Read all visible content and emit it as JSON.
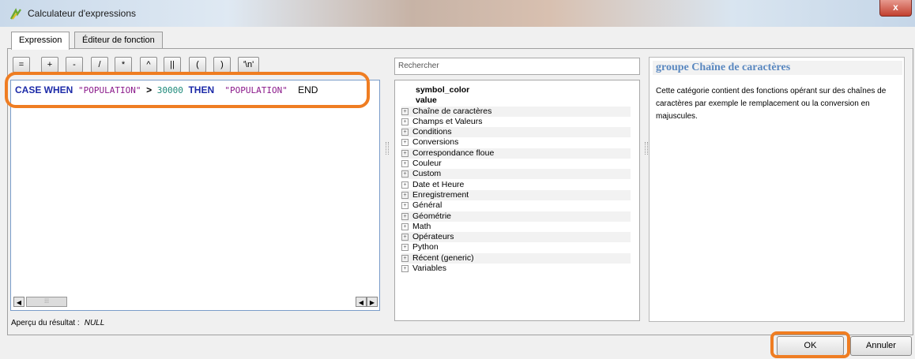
{
  "window": {
    "title": "Calculateur d'expressions",
    "help_label": "?",
    "close_label": "x"
  },
  "tabs": [
    {
      "label": "Expression"
    },
    {
      "label": "Éditeur de fonction"
    }
  ],
  "operators": [
    "=",
    "+",
    "-",
    "/",
    "*",
    "^",
    "||",
    "(",
    ")",
    "'\\n'"
  ],
  "editor": {
    "tokens": {
      "kw1": "CASE WHEN",
      "field1": "\"POPULATION\"",
      "op": ">",
      "num": "30000",
      "kw2": "THEN",
      "field2": "\"POPULATION\"",
      "end": "END"
    }
  },
  "preview": {
    "label": "Aperçu du résultat :",
    "value": "NULL"
  },
  "search": {
    "placeholder": "Rechercher"
  },
  "tree": {
    "fields": [
      "symbol_color",
      "value"
    ],
    "groups": [
      "Chaîne de caractères",
      "Champs et Valeurs",
      "Conditions",
      "Conversions",
      "Correspondance floue",
      "Couleur",
      "Custom",
      "Date et Heure",
      "Enregistrement",
      "Général",
      "Géométrie",
      "Math",
      "Opérateurs",
      "Python",
      "Récent (generic)",
      "Variables"
    ]
  },
  "help": {
    "title": "groupe Chaîne de caractères",
    "description": "Cette catégorie contient des fonctions opérant sur des chaînes de caractères par exemple le remplacement ou la conversion en majuscules."
  },
  "buttons": {
    "ok": "OK",
    "cancel": "Annuler"
  },
  "colors": {
    "highlight": "#ef7d22",
    "keyword": "#1d2ba8",
    "field": "#8b1a8b",
    "number": "#1e8a7a",
    "help_title": "#5a88c0"
  }
}
